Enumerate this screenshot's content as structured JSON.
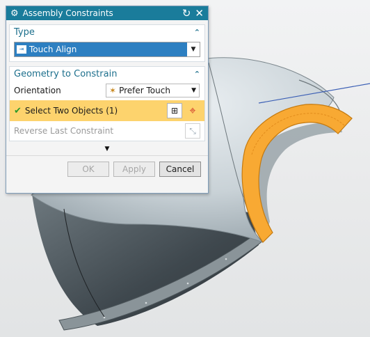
{
  "dialog": {
    "title": "Assembly Constraints",
    "titlebar_icons": [
      "gear-icon",
      "reset-icon",
      "close-icon"
    ]
  },
  "type_section": {
    "heading": "Type",
    "selected": "Touch Align"
  },
  "geometry_section": {
    "heading": "Geometry to Constrain",
    "orientation_label": "Orientation",
    "orientation_value": "Prefer Touch",
    "select_objects_label": "Select Two Objects (1)",
    "reverse_label": "Reverse Last Constraint"
  },
  "buttons": {
    "ok": "OK",
    "apply": "Apply",
    "cancel": "Cancel"
  },
  "colors": {
    "title_bar": "#1a7c9b",
    "section_heading": "#1c6f8c",
    "selection_highlight": "#2d7fc1",
    "selection_row": "#fdd36d",
    "part_highlight": "#f8a933"
  }
}
